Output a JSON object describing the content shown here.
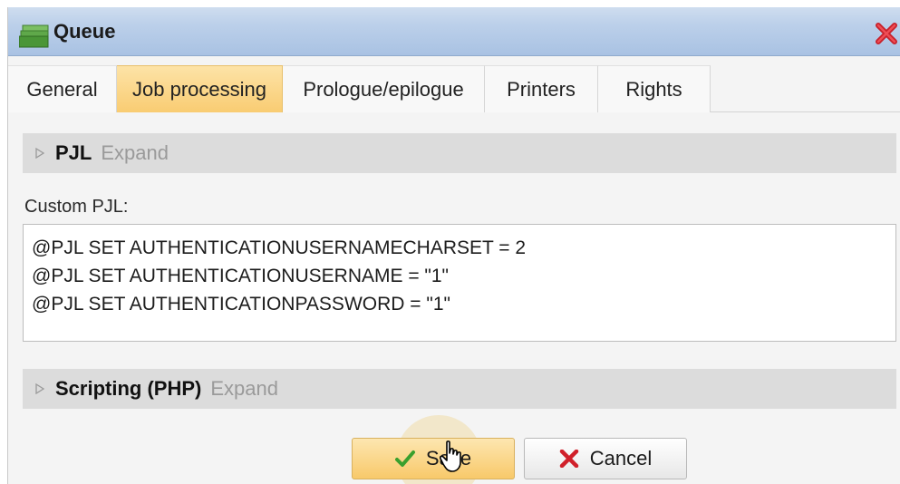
{
  "window": {
    "title": "Queue",
    "icon": "queue-icon",
    "close_icon": "close-icon"
  },
  "tabs": [
    {
      "label": "General",
      "active": false
    },
    {
      "label": "Job processing",
      "active": true
    },
    {
      "label": "Prologue/epilogue",
      "active": false
    },
    {
      "label": "Printers",
      "active": false
    },
    {
      "label": "Rights",
      "active": false
    }
  ],
  "sections": {
    "pjl": {
      "title": "PJL",
      "expand_label": "Expand",
      "icon": "collapsed-triangle-icon"
    },
    "scripting": {
      "title": "Scripting (PHP)",
      "expand_label": "Expand",
      "icon": "collapsed-triangle-icon"
    }
  },
  "custom_pjl": {
    "label": "Custom PJL:",
    "lines": [
      "@PJL SET AUTHENTICATIONUSERNAMECHARSET = 2",
      "@PJL SET AUTHENTICATIONUSERNAME = \"1\"",
      "@PJL SET AUTHENTICATIONPASSWORD = \"1\""
    ]
  },
  "buttons": {
    "save": {
      "label": "Save",
      "icon": "checkmark-icon"
    },
    "cancel": {
      "label": "Cancel",
      "icon": "x-icon"
    }
  },
  "colors": {
    "titlebar": "#bcd0ea",
    "active_tab": "#f9cc72",
    "section_header": "#dcdcdc",
    "check_green": "#3aa02e",
    "cancel_red": "#d0202a"
  }
}
